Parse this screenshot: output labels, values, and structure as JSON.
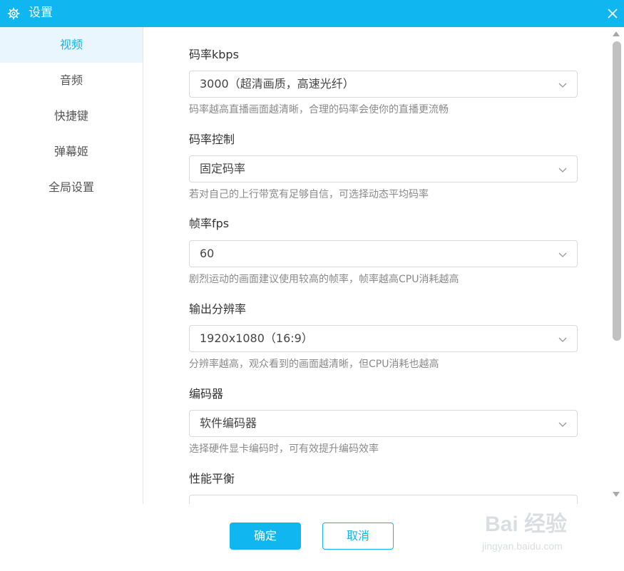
{
  "window": {
    "title": "设置"
  },
  "sidebar": {
    "items": [
      {
        "label": "视频",
        "active": true
      },
      {
        "label": "音频",
        "active": false
      },
      {
        "label": "快捷键",
        "active": false
      },
      {
        "label": "弹幕姬",
        "active": false
      },
      {
        "label": "全局设置",
        "active": false
      }
    ]
  },
  "settings": [
    {
      "label": "码率kbps",
      "value": "3000（超清画质，高速光纤）",
      "hint": "码率越高直播画面越清晰，合理的码率会使你的直播更流畅"
    },
    {
      "label": "码率控制",
      "value": "固定码率",
      "hint": "若对自己的上行带宽有足够自信，可选择动态平均码率"
    },
    {
      "label": "帧率fps",
      "value": "60",
      "hint": "剧烈运动的画面建议使用较高的帧率，帧率越高CPU消耗越高"
    },
    {
      "label": "输出分辨率",
      "value": "1920x1080（16:9）",
      "hint": "分辨率越高，观众看到的画面越清晰，但CPU消耗也越高"
    },
    {
      "label": "编码器",
      "value": "软件编码器",
      "hint": "选择硬件显卡编码时，可有效提升编码效率"
    },
    {
      "label": "性能平衡",
      "value": "",
      "hint": ""
    }
  ],
  "footer": {
    "ok_label": "确定",
    "cancel_label": "取消"
  },
  "watermark": {
    "brand": "Bai 经验",
    "url": "jingyan.baidu.com"
  },
  "colors": {
    "accent": "#10b6f0",
    "active_bg": "#eaf6fd",
    "hint": "#8a8a8a"
  },
  "icons": {
    "title": "gear-icon",
    "close": "close-icon",
    "dropdown": "chevron-down-icon"
  }
}
